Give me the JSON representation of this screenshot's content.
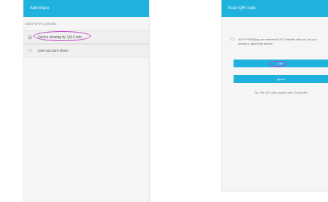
{
  "left": {
    "title": "Add share",
    "section_label": "Share Wi-Fi Controller",
    "items": [
      {
        "label": "Device sharing by QR Code",
        "icon": "qr-code-icon"
      },
      {
        "label": "User account share",
        "icon": "user-icon"
      }
    ]
  },
  "right": {
    "title": "Scan QR code",
    "message": "307*****303@qq.com shared Wi-Fi Controller with you, do you accept or ignore the device?",
    "ok_label": "OK",
    "ignore_label": "Ignore",
    "tip": "Tip: The QR code expires after 10 minutes"
  }
}
